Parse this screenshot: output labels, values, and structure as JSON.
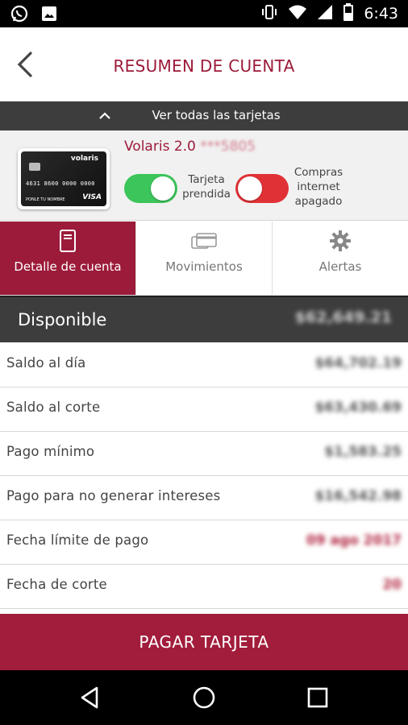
{
  "status_bar": {
    "time": "6:43",
    "icons": [
      "whatsapp-icon",
      "image-icon",
      "vibrate-icon",
      "wifi-icon",
      "signal-icon",
      "battery-icon"
    ]
  },
  "header": {
    "title": "RESUMEN DE CUENTA",
    "back_icon": "chevron-left-icon"
  },
  "cards_bar": {
    "label": "Ver todas las tarjetas",
    "icon": "chevron-up-icon"
  },
  "card": {
    "name": "Volaris 2.0",
    "masked_number": "***5805",
    "thumb": {
      "brand": "volaris",
      "number": "4631 8600 0000 0000",
      "network": "VISA",
      "holder": "PONLE TU NOMBRE"
    },
    "toggle_card": {
      "label_line1": "Tarjeta",
      "label_line2": "prendida",
      "state": "on",
      "color": "#3cc55a"
    },
    "toggle_internet": {
      "label_line1": "Compras",
      "label_line2": "internet",
      "label_line3": "apagado",
      "state": "off",
      "color": "#e03236"
    }
  },
  "tabs": [
    {
      "label": "Detalle de cuenta",
      "icon": "document-icon",
      "active": true
    },
    {
      "label": "Movimientos",
      "icon": "cards-icon",
      "active": false
    },
    {
      "label": "Alertas",
      "icon": "gear-icon",
      "active": false
    }
  ],
  "available": {
    "label": "Disponible",
    "value": "$62,649.21"
  },
  "rows": [
    {
      "label": "Saldo al día",
      "value": "$64,702.19"
    },
    {
      "label": "Saldo al corte",
      "value": "$63,430.69"
    },
    {
      "label": "Pago mínimo",
      "value": "$1,583.25"
    },
    {
      "label": "Pago para no generar intereses",
      "value": "$16,542.98"
    },
    {
      "label": "Fecha límite de pago",
      "value": "09 ago 2017"
    },
    {
      "label": "Fecha de corte",
      "value": "20"
    }
  ],
  "pay_button": {
    "label": "PAGAR TARJETA"
  },
  "colors": {
    "brand": "#9c1b3a",
    "dark_bar": "#3d3d3d",
    "toggle_on": "#3cc55a",
    "toggle_off": "#e03236"
  },
  "nav": {
    "back": "back-triangle-icon",
    "home": "home-circle-icon",
    "recents": "recents-square-icon"
  }
}
